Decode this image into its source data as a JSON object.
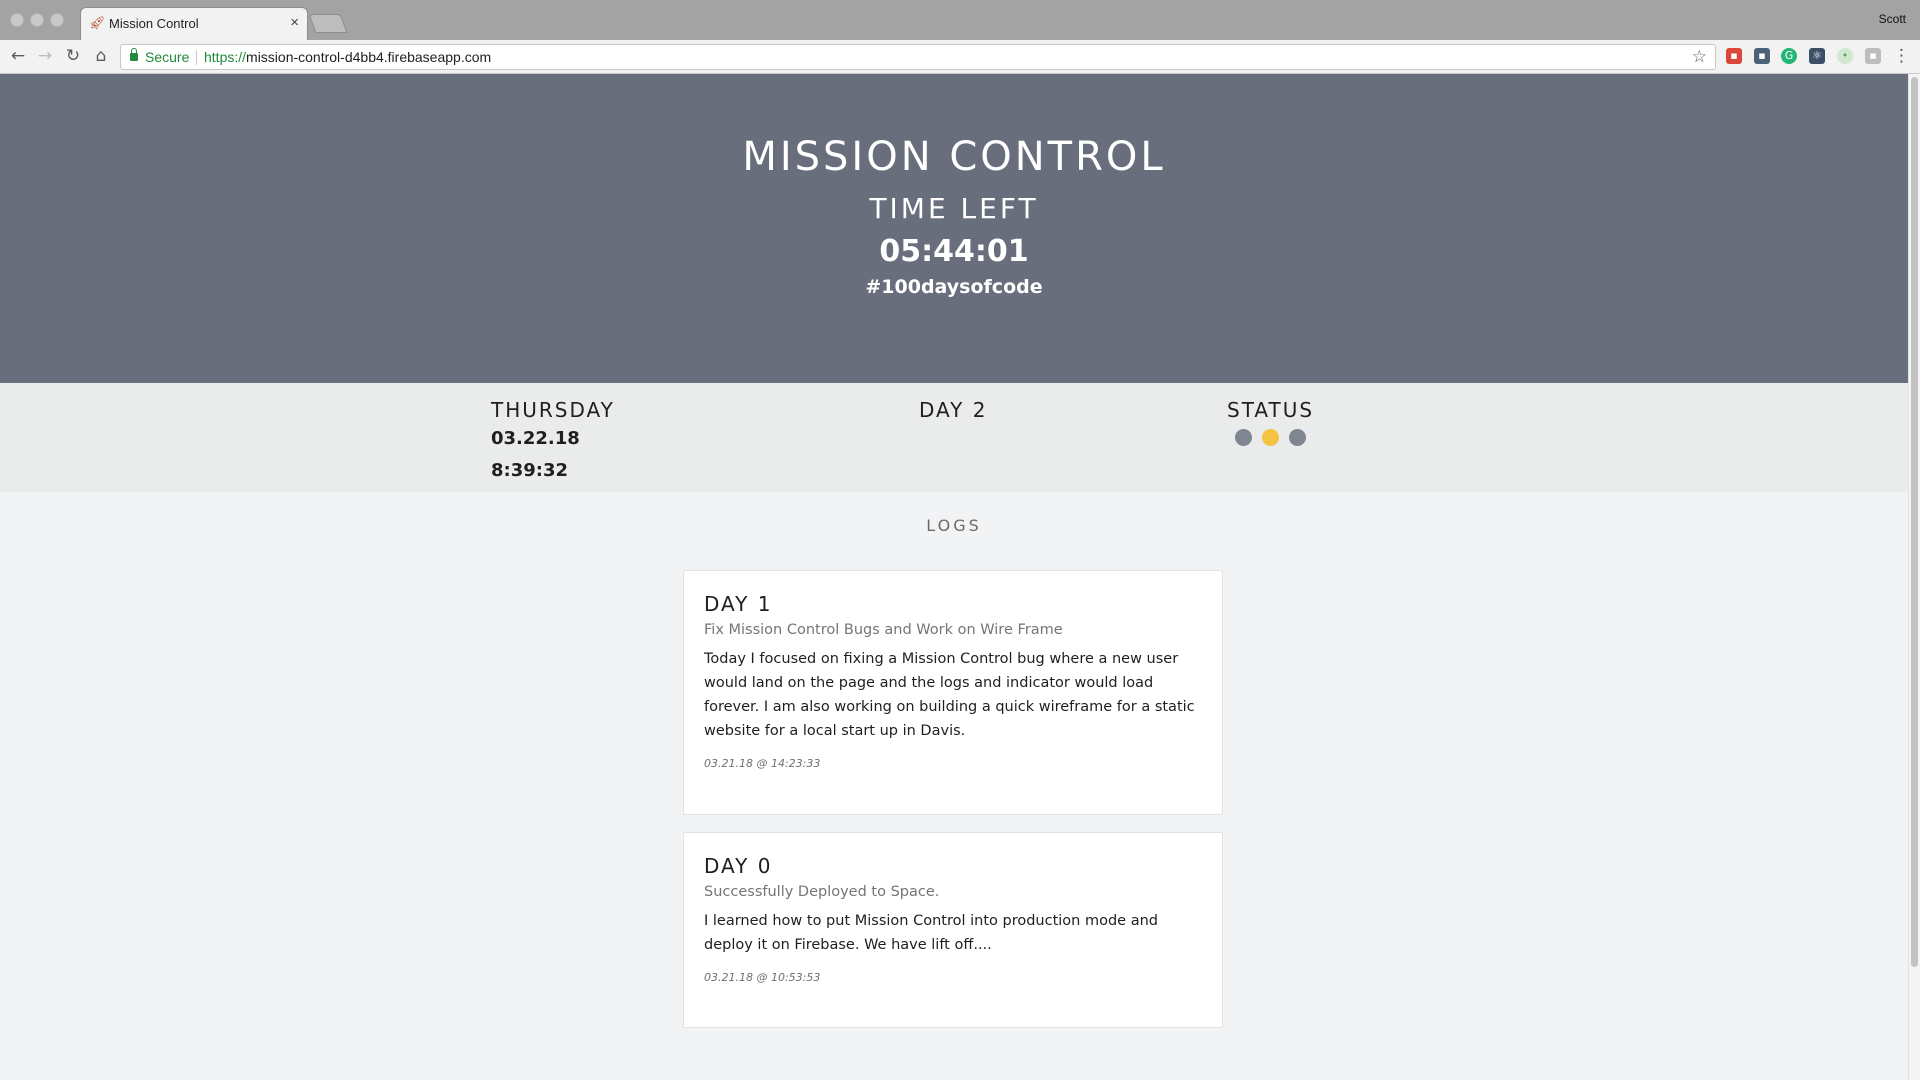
{
  "browser": {
    "tab_title": "Mission Control",
    "tab_close": "×",
    "profile": "Scott",
    "secure_label": "Secure",
    "url_scheme": "https://",
    "url_rest": "mission-control-d4bb4.firebaseapp.com"
  },
  "hero": {
    "title": "MISSION CONTROL",
    "subtitle": "TIME LEFT",
    "countdown": "05:44:01",
    "hashtag": "#100daysofcode",
    "background": "#686e7c"
  },
  "info": {
    "weekday": "THURSDAY",
    "date": "03.22.18",
    "time": "8:39:32",
    "day_label": "DAY 2",
    "status_label": "STATUS",
    "status_dots": [
      "#7f8591",
      "#f5c242",
      "#7f8591"
    ]
  },
  "logs": {
    "heading": "LOGS",
    "entries": [
      {
        "day": "DAY 1",
        "title": "Fix Mission Control Bugs and Work on Wire Frame",
        "body": "Today I focused on fixing a Mission Control bug where a new user would land on the page and the logs and indicator would load forever. I am also working on building a quick wireframe for a static website for a local start up in Davis.",
        "timestamp": "03.21.18 @ 14:23:33"
      },
      {
        "day": "DAY 0",
        "title": "Successfully Deployed to Space.",
        "body": "I learned how to put Mission Control into production mode and deploy it on Firebase. We have lift off....",
        "timestamp": "03.21.18 @ 10:53:53"
      }
    ]
  }
}
